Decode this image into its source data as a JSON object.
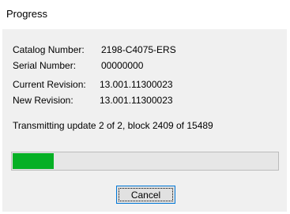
{
  "window": {
    "title": "Progress"
  },
  "info": [
    {
      "label": "Catalog Number:",
      "value": "2198-C4075-ERS"
    },
    {
      "label": "Serial Number:",
      "value": "00000000"
    },
    {
      "label": "Current Revision:",
      "value": "13.001.11300023"
    },
    {
      "label": "New Revision:",
      "value": "13.001.11300023"
    }
  ],
  "status": {
    "text": "Transmitting update 2 of 2,  block 2409 of 15489"
  },
  "progress": {
    "percent": 15.6,
    "color": "#06b025"
  },
  "buttons": {
    "cancel_label": "Cancel"
  }
}
